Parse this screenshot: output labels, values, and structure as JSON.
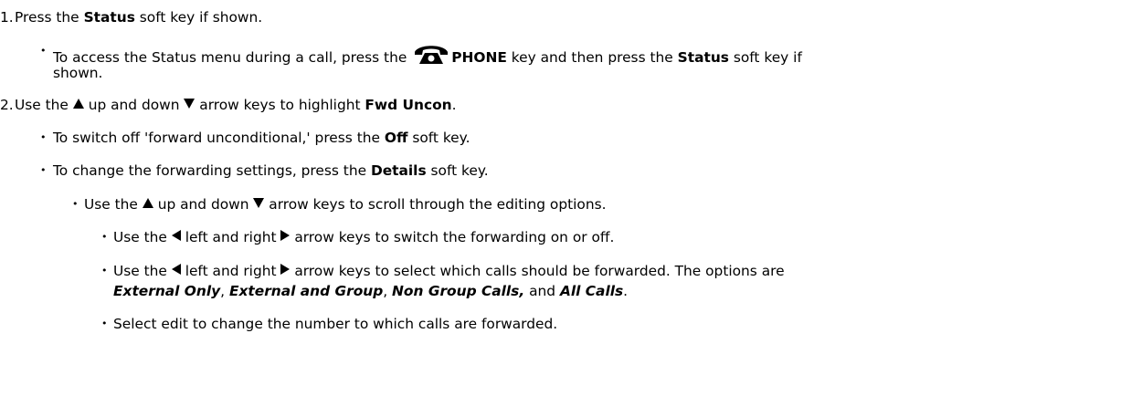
{
  "step1": {
    "number": "1.",
    "text_a": "Press the ",
    "status": "Status",
    "text_b": " soft key if shown."
  },
  "step1_sub": {
    "text_a": "To access the Status menu during a call, press the ",
    "phone": "PHONE",
    "text_b": " key and then press the ",
    "status": "Status",
    "text_c": " soft key if",
    "text_d": "shown."
  },
  "step2": {
    "number": "2.",
    "text_a": "Use the ",
    "text_b": " up and down ",
    "text_c": " arrow keys to highlight ",
    "fwd": "Fwd Uncon",
    "text_d": "."
  },
  "step2_off": {
    "text_a": "To switch off 'forward unconditional,' press the ",
    "off": "Off",
    "text_b": " soft key."
  },
  "step2_details": {
    "text_a": "To change the forwarding settings, press the ",
    "details": "Details",
    "text_b": " soft key."
  },
  "step2_scroll": {
    "text_a": "Use the ",
    "text_b": " up and down ",
    "text_c": " arrow keys to scroll through the editing options."
  },
  "step2_switch": {
    "text_a": "Use the ",
    "text_b": " left and right ",
    "text_c": " arrow keys to switch the forwarding on or off."
  },
  "step2_select": {
    "text_a": "Use the ",
    "text_b": " left and right ",
    "text_c": " arrow keys to select which calls should be forwarded. The options are",
    "opt1": "External Only",
    "sep1": ", ",
    "opt2": "External and Group",
    "sep2": ", ",
    "opt3": "Non Group Calls,",
    "sep3": " and ",
    "opt4": "All Calls",
    "end": "."
  },
  "step2_edit": {
    "text": "Select edit to change the number to which calls are forwarded."
  },
  "icons": {
    "up": "up-arrow-icon",
    "down": "down-arrow-icon",
    "left": "left-arrow-icon",
    "right": "right-arrow-icon",
    "phone": "phone-icon"
  }
}
